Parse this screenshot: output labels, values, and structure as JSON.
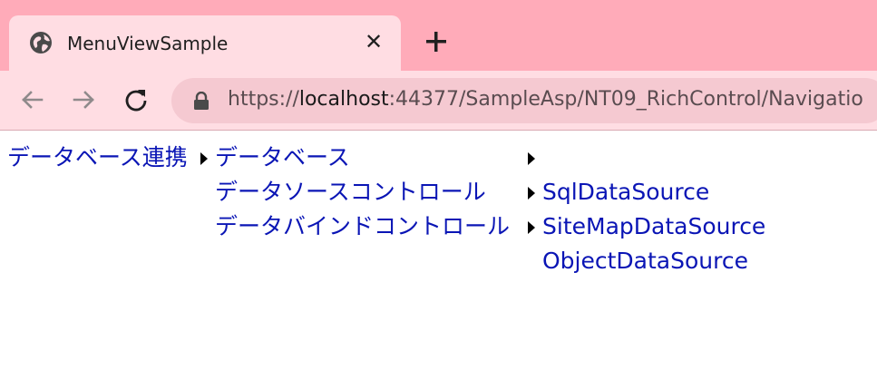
{
  "tab": {
    "title": "MenuViewSample",
    "close_glyph": "✕"
  },
  "toolbar": {
    "url_scheme": "https://",
    "url_host": "localhost",
    "url_rest": ":44377/SampleAsp/NT09_RichControl/Navigatio"
  },
  "menu": {
    "root": "データベース連携",
    "level2": [
      "データベース",
      "データソースコントロール",
      "データバインドコントロール"
    ],
    "level3": [
      "SqlDataSource",
      "SiteMapDataSource",
      "ObjectDataSource"
    ]
  },
  "colors": {
    "tab_strip": "#ffabb9",
    "toolbar": "#ffdde3",
    "link": "#0a15b5"
  }
}
